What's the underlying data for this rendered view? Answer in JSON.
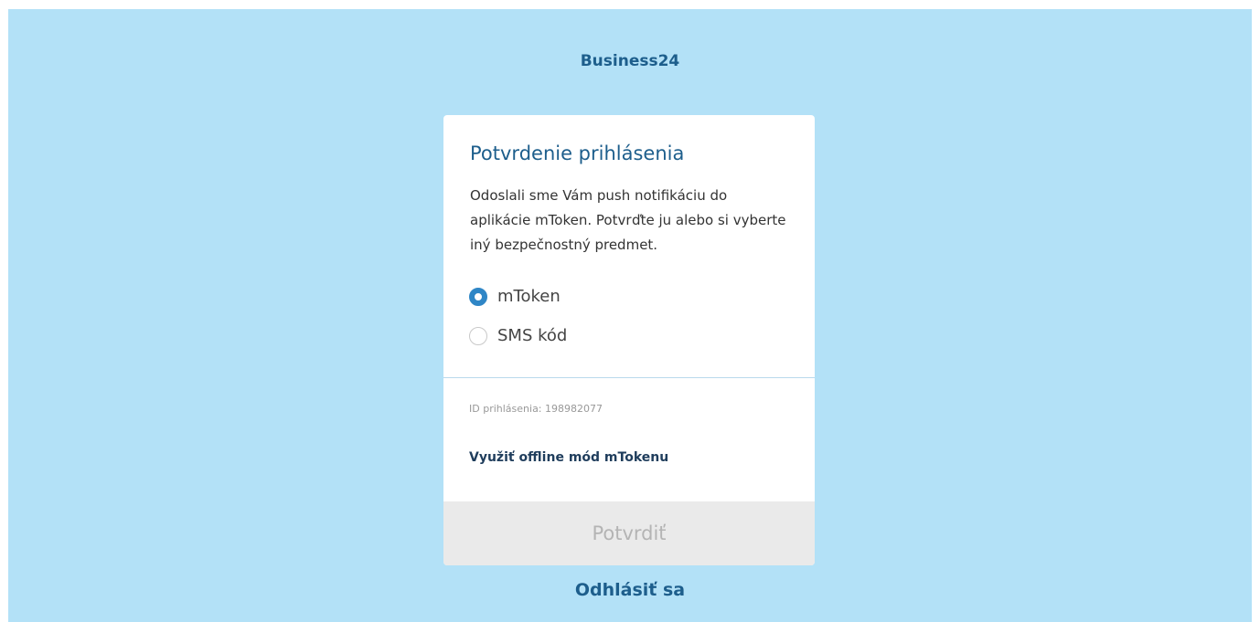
{
  "brand": {
    "title": "Business24"
  },
  "card": {
    "title": "Potvrdenie prihlásenia",
    "description": "Odoslali sme Vám push notifikáciu do aplikácie mToken. Potvrďte ju alebo si vyberte iný bezpečnostný predmet.",
    "options": [
      {
        "label": "mToken",
        "selected": true
      },
      {
        "label": "SMS kód",
        "selected": false
      }
    ],
    "login_id": "ID prihlásenia: 198982077",
    "offline_link": "Využiť offline mód mTokenu",
    "confirm_label": "Potvrdiť"
  },
  "footer": {
    "logout_label": "Odhlásiť sa"
  },
  "colors": {
    "background": "#b3e1f7",
    "brand_text": "#1d5e8c",
    "radio_selected": "#2f86c6",
    "disabled_button_bg": "#eaeaea",
    "disabled_button_text": "#b4b4b4"
  }
}
